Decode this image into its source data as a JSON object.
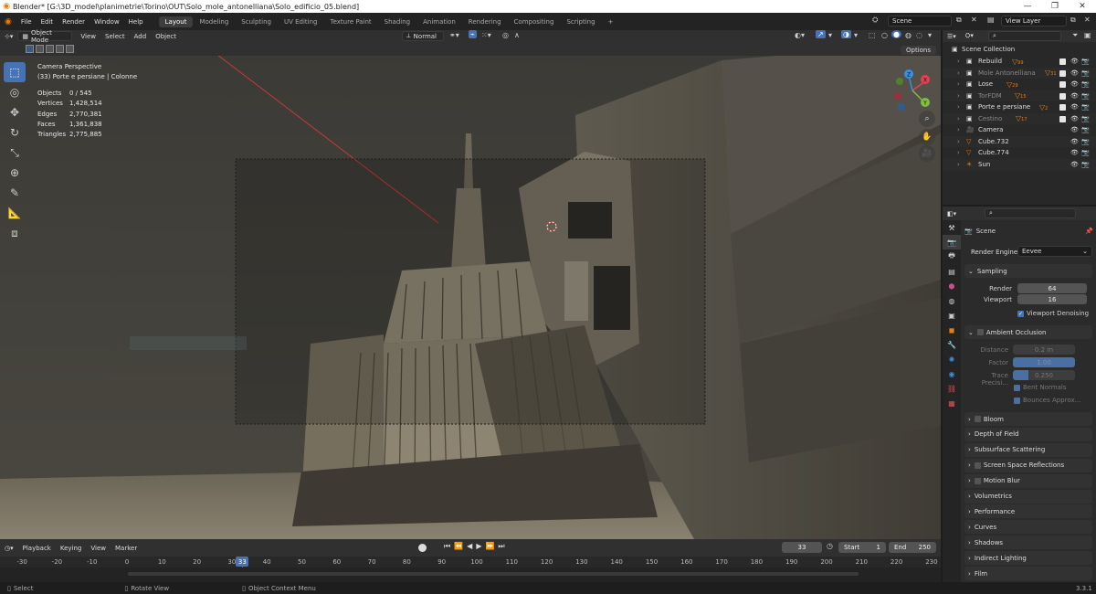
{
  "window": {
    "title": "Blender* [G:\\3D_model\\planimetrie\\Torino\\OUT\\Solo_mole_antonelliana\\Solo_edificio_05.blend]",
    "minimize": "—",
    "maximize": "❐",
    "close": "✕"
  },
  "menu": [
    "File",
    "Edit",
    "Render",
    "Window",
    "Help"
  ],
  "workspaces": [
    {
      "label": "Layout",
      "active": true
    },
    {
      "label": "Modeling"
    },
    {
      "label": "Sculpting"
    },
    {
      "label": "UV Editing"
    },
    {
      "label": "Texture Paint"
    },
    {
      "label": "Shading"
    },
    {
      "label": "Animation"
    },
    {
      "label": "Rendering"
    },
    {
      "label": "Compositing"
    },
    {
      "label": "Scripting"
    }
  ],
  "add_workspace": "+",
  "scene_field": "Scene",
  "view_layer_field": "View Layer",
  "viewport_header": {
    "mode": "Object Mode",
    "view": "View",
    "select": "Select",
    "add": "Add",
    "object": "Object",
    "orientation": "Normal",
    "options": "Options"
  },
  "viewport_info": {
    "line1": "Camera Perspective",
    "line2": "(33) Porte e persiane | Colonne"
  },
  "stats": [
    {
      "k": "Objects",
      "v": "0 / 545"
    },
    {
      "k": "Vertices",
      "v": "1,428,514"
    },
    {
      "k": "Edges",
      "v": "2,770,381"
    },
    {
      "k": "Faces",
      "v": "1,361,838"
    },
    {
      "k": "Triangles",
      "v": "2,775,885"
    }
  ],
  "gizmo": {
    "x": "X",
    "y": "Y",
    "z": "Z"
  },
  "timeline": {
    "playback": "Playback",
    "keying": "Keying",
    "view": "View",
    "marker": "Marker",
    "current_frame": "33",
    "start_label": "Start",
    "start": "1",
    "end_label": "End",
    "end": "250",
    "ticks": [
      "-30",
      "-20",
      "-10",
      "0",
      "10",
      "20",
      "30",
      "40",
      "50",
      "60",
      "70",
      "80",
      "90",
      "100",
      "110",
      "120",
      "130",
      "140",
      "150",
      "160",
      "170",
      "180",
      "190",
      "200",
      "210",
      "220",
      "230"
    ],
    "playhead": "33",
    "playhead_frame": 33
  },
  "statusbar": {
    "select": "Select",
    "rotate": "Rotate View",
    "context": "Object Context Menu",
    "version": "3.3.1"
  },
  "outliner": {
    "root": "Scene Collection",
    "items": [
      {
        "name": "Rebuild",
        "dim": false,
        "count": "99",
        "checked": true
      },
      {
        "name": "Mole Antonelliana",
        "dim": true,
        "count": "31",
        "checked": true
      },
      {
        "name": "Lose",
        "dim": false,
        "count": "29",
        "checked": true
      },
      {
        "name": "TorFDM",
        "dim": true,
        "count": "15",
        "checked": true
      },
      {
        "name": "Porte e persiane",
        "dim": false,
        "count": "2",
        "checked": true
      },
      {
        "name": "Cestino",
        "dim": true,
        "count": "17",
        "checked": true
      },
      {
        "name": "Camera",
        "dim": false,
        "count": "",
        "checked": true
      },
      {
        "name": "Cube.732",
        "dim": false,
        "count": "",
        "checked": true
      },
      {
        "name": "Cube.774",
        "dim": false,
        "count": "",
        "checked": true
      },
      {
        "name": "Sun",
        "dim": false,
        "count": "",
        "checked": true
      }
    ]
  },
  "properties": {
    "scene": "Scene",
    "render_engine_label": "Render Engine",
    "render_engine": "Eevee",
    "sampling": "Sampling",
    "render_label": "Render",
    "render_value": "64",
    "viewport_label": "Viewport",
    "viewport_value": "16",
    "viewport_denoising": "Viewport Denoising",
    "ambient_occlusion": "Ambient Occlusion",
    "distance_label": "Distance",
    "distance_value": "0.2 m",
    "factor_label": "Factor",
    "factor_value": "1.00",
    "trace_label": "Trace Precisi...",
    "trace_value": "0.250",
    "bent_normals": "Bent Normals",
    "bounces": "Bounces Approx...",
    "panels": [
      {
        "label": "Bloom",
        "checkbox": true
      },
      {
        "label": "Depth of Field",
        "checkbox": false
      },
      {
        "label": "Subsurface Scattering",
        "checkbox": false
      },
      {
        "label": "Screen Space Reflections",
        "checkbox": true
      },
      {
        "label": "Motion Blur",
        "checkbox": true
      },
      {
        "label": "Volumetrics",
        "checkbox": false
      },
      {
        "label": "Performance",
        "checkbox": false
      },
      {
        "label": "Curves",
        "checkbox": false
      },
      {
        "label": "Shadows",
        "checkbox": false
      },
      {
        "label": "Indirect Lighting",
        "checkbox": false
      },
      {
        "label": "Film",
        "checkbox": false
      }
    ]
  },
  "colors": {
    "accent": "#4772b3",
    "orange": "#e87d0d",
    "x_axis": "#e53f51",
    "y_axis": "#7fbf3f",
    "z_axis": "#3b8fde"
  }
}
